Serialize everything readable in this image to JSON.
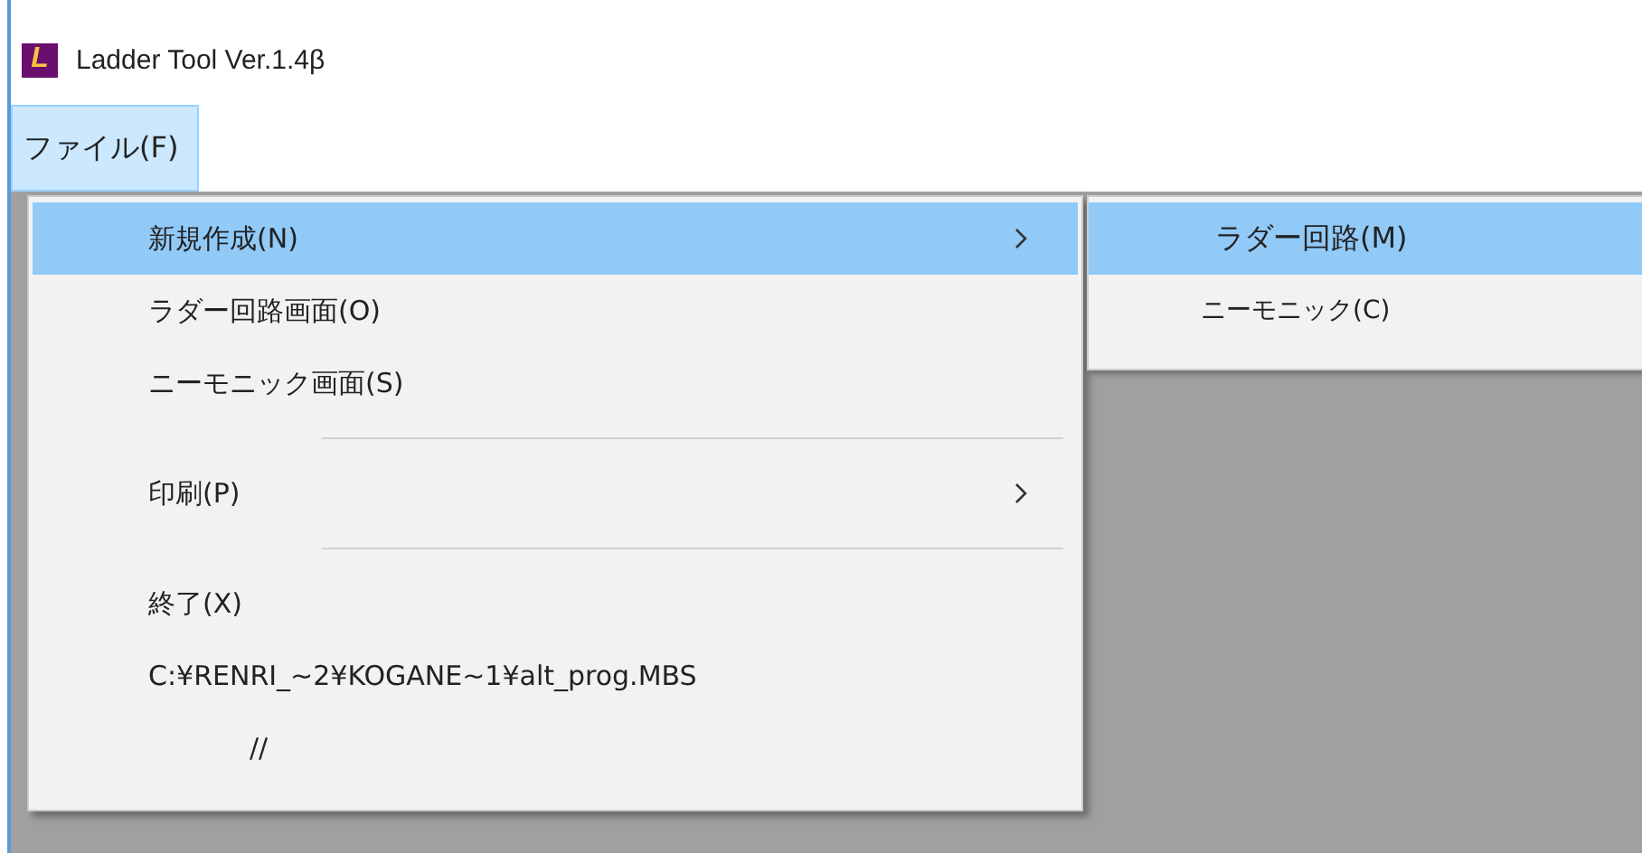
{
  "window": {
    "title": "Ladder Tool Ver.1.4β",
    "logo_letter": "L"
  },
  "menu_bar": [
    {
      "label": "ファイル(F)",
      "selected": true
    }
  ],
  "file_menu": [
    {
      "kind": "item",
      "label": "新規作成(N)",
      "selected": true,
      "submenu": true
    },
    {
      "kind": "item",
      "label": "ラダー回路画面(O)",
      "selected": false,
      "submenu": false
    },
    {
      "kind": "item",
      "label": "ニーモニック画面(S)",
      "selected": false,
      "submenu": false
    },
    {
      "kind": "separator"
    },
    {
      "kind": "item",
      "label": "印刷(P)",
      "selected": false,
      "submenu": true
    },
    {
      "kind": "separator"
    },
    {
      "kind": "item",
      "label": "終了(X)",
      "selected": false,
      "submenu": false
    },
    {
      "kind": "item",
      "label": "C:¥RENRI_~2¥KOGANE~1¥alt_prog.MBS",
      "selected": false,
      "submenu": false
    },
    {
      "kind": "item",
      "label": "//",
      "selected": false,
      "submenu": false,
      "indent": true
    }
  ],
  "submenu": [
    {
      "label": "ラダー回路(M)",
      "selected": true
    },
    {
      "label": "ニーモニック(C)",
      "selected": false
    }
  ]
}
